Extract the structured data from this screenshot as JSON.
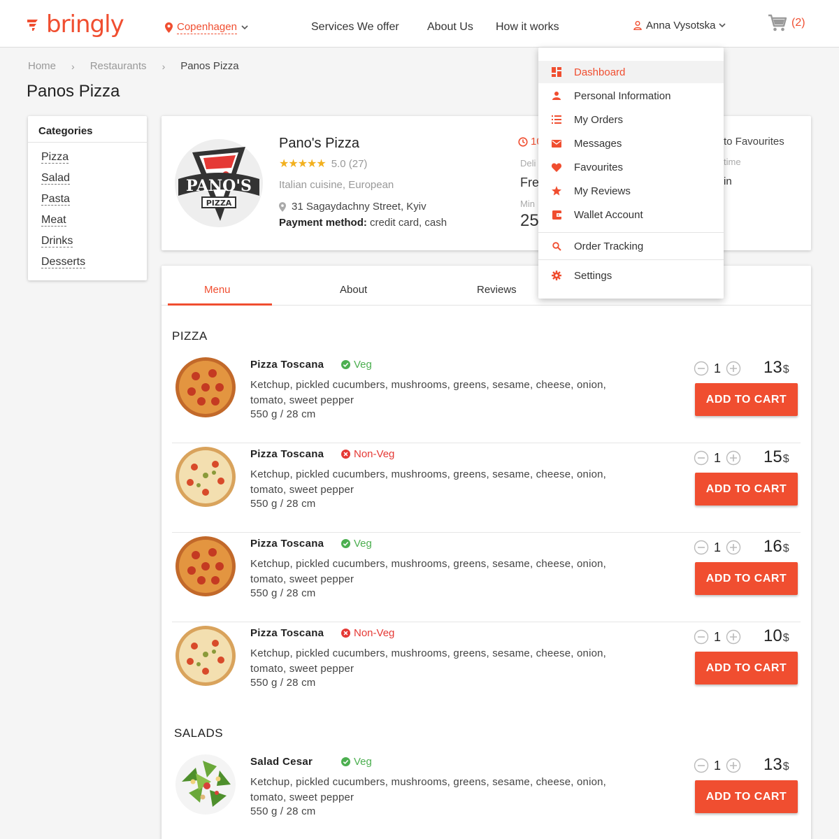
{
  "header": {
    "logo_text": "bringly",
    "city": "Copenhagen",
    "nav": [
      "Services  We offer",
      "About Us",
      "How it works"
    ],
    "user_name": "Anna Vysotska",
    "cart_count": "(2)",
    "accent_color": "#f04e30"
  },
  "breadcrumb": [
    "Home",
    "Restaurants",
    "Panos Pizza"
  ],
  "page_title": "Panos Pizza",
  "categories": {
    "title": "Categories",
    "items": [
      "Pizza",
      "Salad",
      "Pasta",
      "Meat",
      "Drinks",
      "Desserts"
    ]
  },
  "restaurant": {
    "name": "Pano's Pizza",
    "logo_text": "PANO'S",
    "logo_subtext": "PIZZA",
    "rating": "5.0 (27)",
    "stars": "★★★★★",
    "cuisine": "Italian cuisine, European",
    "address": "31 Sagaydachny Street, Kyiv",
    "payment_label": "Payment method:",
    "payment_value": "credit card, cash",
    "clock_partial": "10",
    "delivery_partial": "Deli",
    "free_partial": "Fre",
    "min_partial": "Min",
    "min_value_partial": "25",
    "favourites_partial": "to Favourites",
    "time_partial": "time",
    "in_partial": "in"
  },
  "tabs": [
    "Menu",
    "About",
    "Reviews"
  ],
  "sections": [
    {
      "title": "PIZZA",
      "items": [
        {
          "name": "Pizza Toscana",
          "tag": "Veg",
          "desc": "Ketchup, pickled cucumbers, mushrooms, greens, sesame, cheese, onion, tomato, sweet pepper",
          "weight": "550 g / 28 cm",
          "qty": "1",
          "price": "13",
          "currency": "$",
          "button": "ADD TO CART"
        },
        {
          "name": "Pizza Toscana",
          "tag": "Non-Veg",
          "desc": "Ketchup, pickled cucumbers, mushrooms, greens, sesame, cheese, onion, tomato, sweet pepper",
          "weight": "550 g / 28 cm",
          "qty": "1",
          "price": "15",
          "currency": "$",
          "button": "ADD TO CART"
        },
        {
          "name": "Pizza Toscana",
          "tag": "Veg",
          "desc": "Ketchup, pickled cucumbers, mushrooms, greens, sesame, cheese, onion, tomato, sweet pepper",
          "weight": "550 g / 28 cm",
          "qty": "1",
          "price": "16",
          "currency": "$",
          "button": "ADD TO CART"
        },
        {
          "name": "Pizza Toscana",
          "tag": "Non-Veg",
          "desc": "Ketchup, pickled cucumbers, mushrooms, greens, sesame, cheese, onion, tomato, sweet pepper",
          "weight": "550 g / 28 cm",
          "qty": "1",
          "price": "10",
          "currency": "$",
          "button": "ADD TO CART"
        }
      ]
    },
    {
      "title": "SALADS",
      "items": [
        {
          "name": "Salad Cesar",
          "tag": "Veg",
          "desc": "Ketchup, pickled cucumbers, mushrooms, greens, sesame, cheese, onion, tomato, sweet pepper",
          "weight": "550 g / 28 cm",
          "qty": "1",
          "price": "13",
          "currency": "$",
          "button": "ADD TO CART"
        }
      ]
    }
  ],
  "user_menu": {
    "items": [
      {
        "label": "Dashboard",
        "icon": "dashboard-icon"
      },
      {
        "label": "Personal Information",
        "icon": "person-icon"
      },
      {
        "label": "My Orders",
        "icon": "list-icon"
      },
      {
        "label": "Messages",
        "icon": "mail-icon"
      },
      {
        "label": "Favourites",
        "icon": "heart-icon"
      },
      {
        "label": "My Reviews",
        "icon": "star-icon"
      },
      {
        "label": "Wallet Account",
        "icon": "wallet-icon"
      },
      {
        "label": "Order Tracking",
        "icon": "search-icon"
      },
      {
        "label": "Settings",
        "icon": "gear-icon"
      }
    ]
  }
}
